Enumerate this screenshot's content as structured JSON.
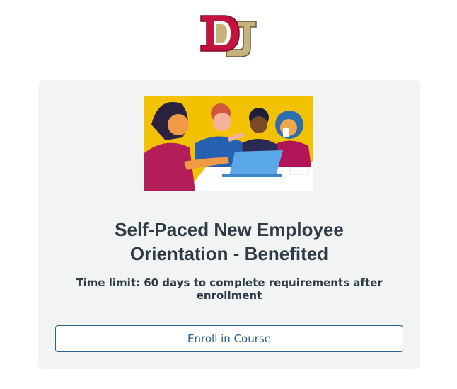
{
  "logo": {
    "alt_letters": "DU",
    "primary_color": "#c4123f",
    "secondary_color": "#c6b27b"
  },
  "hero": {
    "icon": "team-meeting-illustration",
    "background_color": "#f2c200"
  },
  "course": {
    "title_line1": "Self-Paced New Employee",
    "title_line2": "Orientation - Benefited",
    "time_limit": "Time limit: 60 days to complete requirements after enrollment"
  },
  "actions": {
    "enroll_label": "Enroll in Course"
  },
  "colors": {
    "card_bg": "#f2f3f3",
    "button_text": "#2d5f8a",
    "text": "#2d3b45"
  }
}
